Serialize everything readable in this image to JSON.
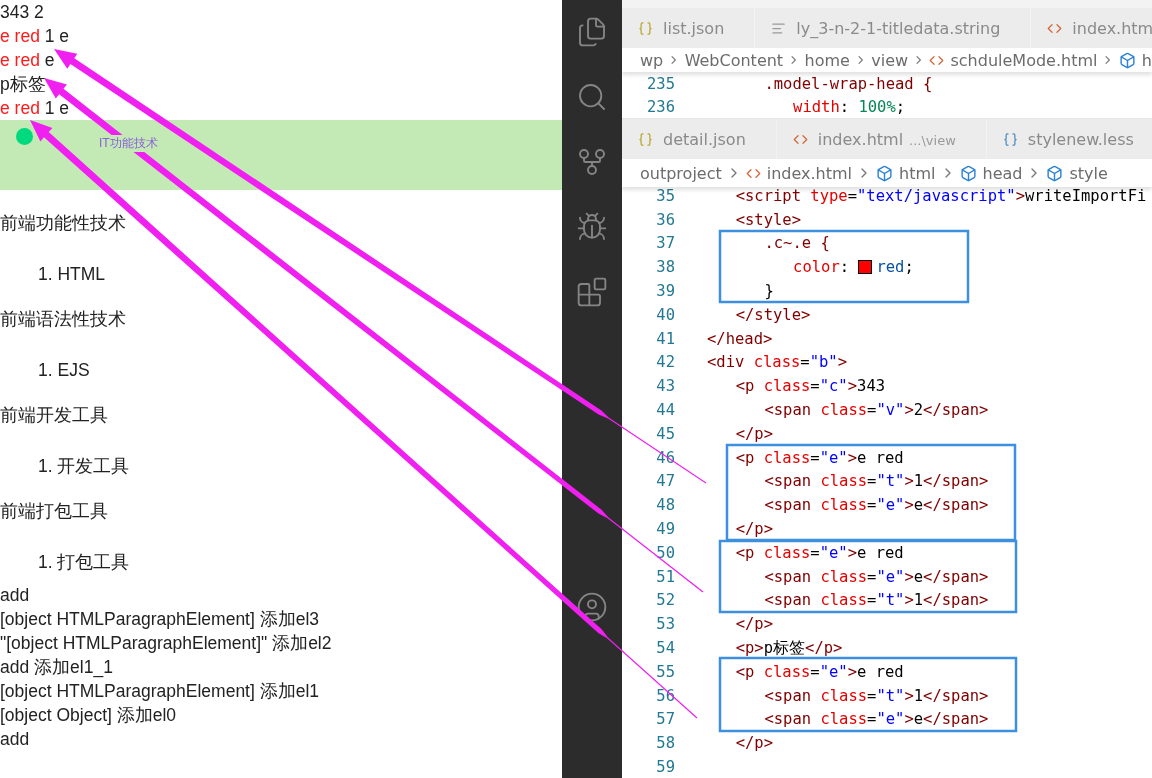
{
  "browser_output": {
    "lines": [
      {
        "kind": "plain",
        "text": "343 2"
      },
      {
        "kind": "red",
        "red": "e red",
        "text": "1 e"
      },
      {
        "kind": "red",
        "red": "e red",
        "text": "e"
      },
      {
        "kind": "plain",
        "text": "p标签"
      },
      {
        "kind": "red",
        "red": "e red",
        "text": "1 e"
      }
    ],
    "banner": {
      "label": "IT功能技术"
    },
    "sections": [
      {
        "heading": "前端功能性技术",
        "item": "1. HTML"
      },
      {
        "heading": "前端语法性技术",
        "item": "1. EJS"
      },
      {
        "heading": "前端开发工具",
        "item": "1. 开发工具"
      },
      {
        "heading": "前端打包工具",
        "item": "1. 打包工具"
      }
    ],
    "log": [
      "add",
      "[object HTMLParagraphElement] 添加el3",
      "\"[object HTMLParagraphElement]\" 添加el2",
      "add 添加el1_1",
      "[object HTMLParagraphElement] 添加el1",
      "[object Object] 添加el0",
      "add"
    ]
  },
  "editor": {
    "top_group": {
      "tabs": [
        {
          "kind": "json",
          "label": "list.json"
        },
        {
          "kind": "text",
          "label": "ly_3-n-2-1-titledata.string"
        },
        {
          "kind": "html",
          "label": "index.htm"
        }
      ],
      "breadcrumb": [
        {
          "kind": "folder",
          "label": "wp"
        },
        {
          "kind": "folder",
          "label": "WebContent"
        },
        {
          "kind": "folder",
          "label": "home"
        },
        {
          "kind": "folder",
          "label": "view"
        },
        {
          "kind": "html",
          "label": "schduleMode.html"
        },
        {
          "kind": "element",
          "label": "h"
        }
      ],
      "lines": [
        {
          "n": "235",
          "kind": "css",
          "code": ".model-wrap-head {",
          "children": [
            {
              "n": "236",
              "kind": "css",
              "code": "width: 100%;"
            }
          ]
        }
      ]
    },
    "bottom_group": {
      "tabs": [
        {
          "kind": "json",
          "label": "detail.json"
        },
        {
          "kind": "html",
          "label": "index.html",
          "description": "...\\view"
        },
        {
          "kind": "less",
          "label": "stylenew.less"
        }
      ],
      "breadcrumb": [
        {
          "kind": "folder",
          "label": "outproject"
        },
        {
          "kind": "html",
          "label": "index.html"
        },
        {
          "kind": "element",
          "label": "html"
        },
        {
          "kind": "element",
          "label": "head"
        },
        {
          "kind": "element",
          "label": "style"
        }
      ],
      "head_content": [
        {
          "n": "35",
          "kind": "html",
          "code": "<script type=\"text/javascript\">writeImportFi"
        },
        {
          "n": "36",
          "kind": "html",
          "code": "<style>",
          "children": [
            {
              "n": "37",
              "kind": "css",
              "code": ".c~.e {",
              "children": [
                {
                  "n": "38",
                  "kind": "css",
                  "code": "color: red;",
                  "swatch": true
                }
              ]
            },
            {
              "n": "39",
              "kind": "css",
              "code": "}"
            }
          ]
        },
        {
          "n": "40",
          "kind": "html",
          "code": "</style>"
        }
      ],
      "lines": [
        {
          "n": "41",
          "kind": "html",
          "code": "</head>"
        },
        {
          "n": "42",
          "kind": "html",
          "code": "<div class=\"b\">",
          "children": [
            {
              "n": "43",
              "kind": "html",
              "code": "<p class=\"c\">343",
              "children": [
                {
                  "n": "44",
                  "kind": "html",
                  "code": "<span class=\"v\">2</span>"
                }
              ]
            },
            {
              "n": "45",
              "kind": "html",
              "code": "</p>"
            },
            {
              "n": "46",
              "kind": "html",
              "code": "<p class=\"e\">e red",
              "children": [
                {
                  "n": "47",
                  "kind": "html",
                  "code": "<span class=\"t\">1</span>"
                },
                {
                  "n": "48",
                  "kind": "html",
                  "code": "<span class=\"e\">e</span>"
                }
              ]
            },
            {
              "n": "49",
              "kind": "html",
              "code": "</p>"
            },
            {
              "n": "50",
              "kind": "html",
              "code": "<p class=\"e\">e red",
              "children": [
                {
                  "n": "51",
                  "kind": "html",
                  "code": "<span class=\"e\">e</span>"
                },
                {
                  "n": "52",
                  "kind": "html",
                  "code": "<span class=\"t\">1</span>"
                }
              ]
            },
            {
              "n": "53",
              "kind": "html",
              "code": "</p>"
            },
            {
              "n": "54",
              "kind": "html",
              "code": "<p>p标签</p>"
            },
            {
              "n": "55",
              "kind": "html",
              "code": "<p class=\"e\">e red",
              "children": [
                {
                  "n": "56",
                  "kind": "html",
                  "code": "<span class=\"t\">1</span>"
                },
                {
                  "n": "57",
                  "kind": "html",
                  "code": "<span class=\"e\">e</span>"
                }
              ]
            },
            {
              "n": "58",
              "kind": "html",
              "code": "</p>"
            }
          ]
        },
        {
          "n": "59"
        }
      ]
    }
  }
}
